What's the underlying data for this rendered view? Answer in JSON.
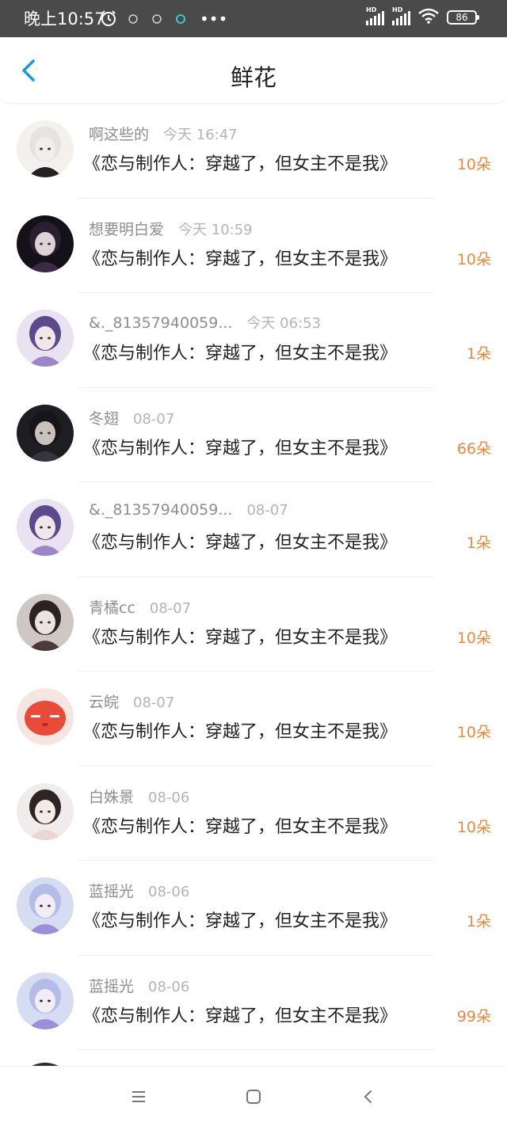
{
  "status_bar": {
    "time": "晚上10:57",
    "battery": "86",
    "signal_hd_1": "HD",
    "signal_hd_2": "HD"
  },
  "header": {
    "title": "鲜花",
    "accent": "#1e96e6"
  },
  "colors": {
    "quantity": "#e9883f",
    "name": "#8e8e8e",
    "time": "#b4b4b4",
    "text": "#222222"
  },
  "rows": [
    {
      "name": "啊这些的",
      "time": "今天 16:47",
      "book": "《恋与制作人：穿越了，但女主不是我》",
      "qty": "10朵"
    },
    {
      "name": "想要明白爱",
      "time": "今天 10:59",
      "book": "《恋与制作人：穿越了，但女主不是我》",
      "qty": "10朵"
    },
    {
      "name": "&._81357940059...",
      "time": "今天 06:53",
      "book": "《恋与制作人：穿越了，但女主不是我》",
      "qty": "1朵"
    },
    {
      "name": "冬翅",
      "time": "08-07",
      "book": "《恋与制作人：穿越了，但女主不是我》",
      "qty": "66朵"
    },
    {
      "name": "&._81357940059...",
      "time": "08-07",
      "book": "《恋与制作人：穿越了，但女主不是我》",
      "qty": "1朵"
    },
    {
      "name": "青橘cc",
      "time": "08-07",
      "book": "《恋与制作人：穿越了，但女主不是我》",
      "qty": "10朵"
    },
    {
      "name": "云皖",
      "time": "08-07",
      "book": "《恋与制作人：穿越了，但女主不是我》",
      "qty": "10朵"
    },
    {
      "name": "白姝景",
      "time": "08-06",
      "book": "《恋与制作人：穿越了，但女主不是我》",
      "qty": "10朵"
    },
    {
      "name": "蓝摇光",
      "time": "08-06",
      "book": "《恋与制作人：穿越了，但女主不是我》",
      "qty": "1朵"
    },
    {
      "name": "蓝摇光",
      "time": "08-06",
      "book": "《恋与制作人：穿越了，但女主不是我》",
      "qty": "99朵"
    }
  ],
  "nav_bar": {
    "icons": [
      "menu-icon",
      "home-icon",
      "back-icon"
    ]
  }
}
